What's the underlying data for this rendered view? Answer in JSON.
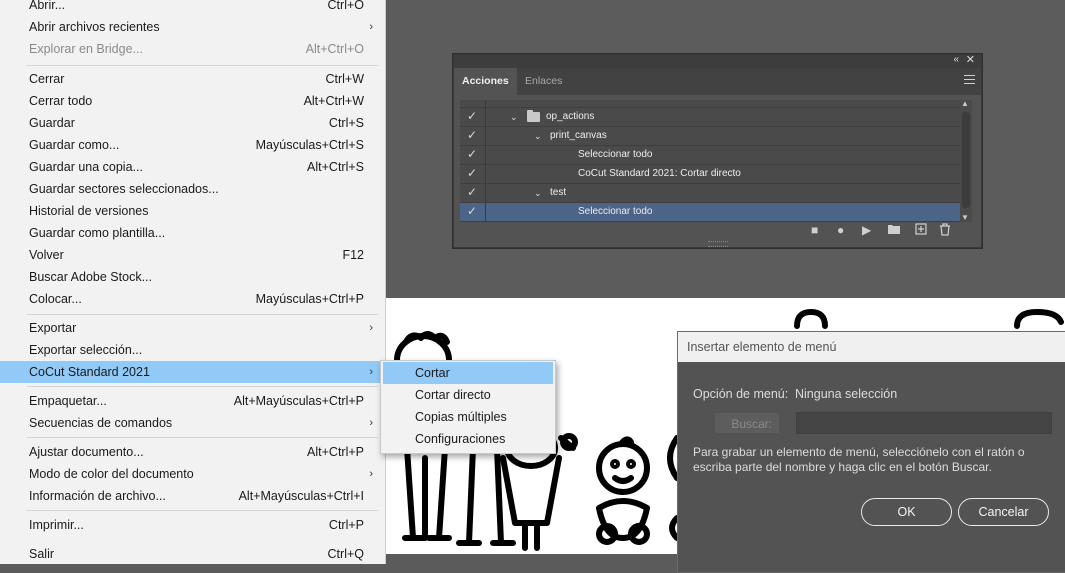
{
  "file_menu": {
    "items": [
      {
        "label": "Abrir...",
        "shortcut": "Ctrl+O"
      },
      {
        "label": "Abrir archivos recientes",
        "shortcut": ""
      },
      {
        "label": "Explorar en Bridge...",
        "shortcut": "Alt+Ctrl+O"
      },
      {
        "label": "Cerrar",
        "shortcut": "Ctrl+W"
      },
      {
        "label": "Cerrar todo",
        "shortcut": "Alt+Ctrl+W"
      },
      {
        "label": "Guardar",
        "shortcut": "Ctrl+S"
      },
      {
        "label": "Guardar como...",
        "shortcut": "Mayúsculas+Ctrl+S"
      },
      {
        "label": "Guardar una copia...",
        "shortcut": "Alt+Ctrl+S"
      },
      {
        "label": "Guardar sectores seleccionados...",
        "shortcut": ""
      },
      {
        "label": "Historial de versiones",
        "shortcut": ""
      },
      {
        "label": "Guardar como plantilla...",
        "shortcut": ""
      },
      {
        "label": "Volver",
        "shortcut": "F12"
      },
      {
        "label": "Buscar Adobe Stock...",
        "shortcut": ""
      },
      {
        "label": "Colocar...",
        "shortcut": "Mayúsculas+Ctrl+P"
      },
      {
        "label": "Exportar",
        "shortcut": ""
      },
      {
        "label": "Exportar selección...",
        "shortcut": ""
      },
      {
        "label": "CoCut Standard 2021",
        "shortcut": ""
      },
      {
        "label": "Empaquetar...",
        "shortcut": "Alt+Mayúsculas+Ctrl+P"
      },
      {
        "label": "Secuencias de comandos",
        "shortcut": ""
      },
      {
        "label": "Ajustar documento...",
        "shortcut": "Alt+Ctrl+P"
      },
      {
        "label": "Modo de color del documento",
        "shortcut": ""
      },
      {
        "label": "Información de archivo...",
        "shortcut": "Alt+Mayúsculas+Ctrl+I"
      },
      {
        "label": "Imprimir...",
        "shortcut": "Ctrl+P"
      },
      {
        "label": "Salir",
        "shortcut": "Ctrl+Q"
      }
    ]
  },
  "submenu": {
    "items": [
      "Cortar",
      "Cortar directo",
      "Copias múltiples",
      "Configuraciones"
    ]
  },
  "actions_panel": {
    "tabs": [
      "Acciones",
      "Enlaces"
    ],
    "rows": [
      "op_actions",
      "print_canvas",
      "Seleccionar todo",
      "CoCut Standard 2021: Cortar directo",
      "test",
      "Seleccionar todo"
    ]
  },
  "dialog": {
    "title": "Insertar elemento de menú",
    "option_label": "Opción de menú:",
    "option_value": "Ninguna selección",
    "search_button": "Buscar:",
    "description": "Para grabar un elemento de menú, selecciónelo con el ratón o escriba parte del nombre y haga clic en el botón Buscar.",
    "ok": "OK",
    "cancel": "Cancelar"
  },
  "colors": {
    "menu_highlight": "#91c9f7",
    "panel_bg": "#535353",
    "selected_row": "#4b6488"
  }
}
